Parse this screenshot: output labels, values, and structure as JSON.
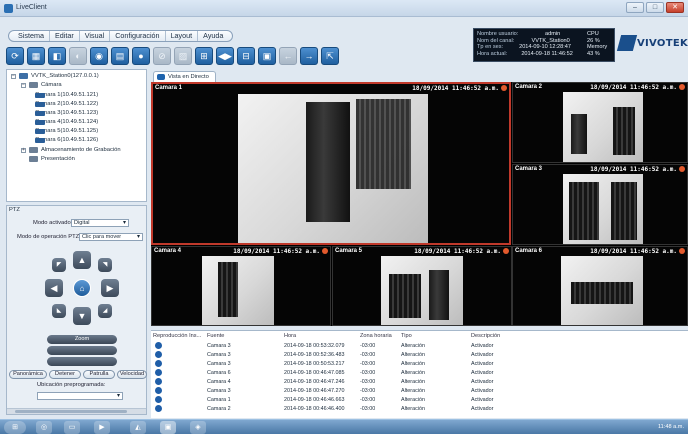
{
  "window": {
    "title": "LiveClient"
  },
  "menu": [
    "Sistema",
    "Editar",
    "Visual",
    "Configuración",
    "Layout",
    "Ayuda"
  ],
  "toolbar_icons": [
    "refresh-icon",
    "layout-icon",
    "snapshot-icon",
    "playback-icon",
    "camera-icon",
    "print-icon",
    "record-icon",
    "disabled-icon",
    "image-icon",
    "grid-icon",
    "sequence-icon",
    "multiview-icon",
    "fullscreen-icon",
    "back-icon",
    "forward-icon",
    "exit-icon"
  ],
  "status": {
    "rows": [
      {
        "k": "Nombre usuario:",
        "v": "admin",
        "k2": "CPU",
        "v2": ""
      },
      {
        "k": "Nom del canal:",
        "v": "VVTK_Station0",
        "k2": "",
        "v2": "26 %"
      },
      {
        "k": "Tp en ses:",
        "v": "2014-09-10 12:28:47",
        "k2": "Memory",
        "v2": ""
      },
      {
        "k": "Hora actual:",
        "v": "2014-09-18 11:46:52",
        "k2": "",
        "v2": "43 %"
      }
    ]
  },
  "brand": "VIVOTEK",
  "tree": {
    "root": "VVTK_Station0(127.0.0.1)",
    "group": "Cámara",
    "cameras": [
      "Camara 1(10.49.51.121)",
      "Camara 2(10.49.51.122)",
      "Camara 3(10.49.51.123)",
      "Camara 4(10.49.51.124)",
      "Camara 5(10.49.51.125)",
      "Camara 6(10.49.51.126)"
    ],
    "storage": "Almacenamiento de Grabación",
    "presentation": "Presentación"
  },
  "ptz": {
    "header": "PTZ",
    "mode_label": "Modo activado:",
    "mode_value": "Digital",
    "op_label": "Modo de operación PTZ:",
    "op_value": "Clic para mover",
    "zoom_label": "Zoom",
    "buttons": [
      "Panorámica",
      "Detener",
      "Patrulla",
      "Velocidad"
    ],
    "preset_label": "Ubicación preprogramada:"
  },
  "main": {
    "tab": "Vista en Directo",
    "cameras": [
      {
        "name": "Camara 1",
        "time": "18/09/2014 11:46:52 a.m."
      },
      {
        "name": "Camara 2",
        "time": "18/09/2014 11:46:52 a.m."
      },
      {
        "name": "Camara 3",
        "time": "18/09/2014 11:46:52 a.m."
      },
      {
        "name": "Camara 4",
        "time": "18/09/2014 11:46:52 a.m."
      },
      {
        "name": "Camara 5",
        "time": "18/09/2014 11:46:52 a.m."
      },
      {
        "name": "Camara 6",
        "time": "18/09/2014 11:46:52 a.m."
      }
    ]
  },
  "events": {
    "headers": [
      "Reproducción Ins...",
      "Fuente",
      "Hora",
      "Zona horaria",
      "Tipo",
      "Descripción"
    ],
    "rows": [
      [
        "Camara 3",
        "2014-09-18 00:53:32.079",
        "-03:00",
        "Alteración",
        "Activador"
      ],
      [
        "Camara 3",
        "2014-09-18 00:52:36.483",
        "-03:00",
        "Alteración",
        "Activador"
      ],
      [
        "Camara 3",
        "2014-09-18 00:50:53.217",
        "-03:00",
        "Alteración",
        "Activador"
      ],
      [
        "Camara 6",
        "2014-09-18 00:46:47.085",
        "-03:00",
        "Alteración",
        "Activador"
      ],
      [
        "Camara 4",
        "2014-09-18 00:46:47.246",
        "-03:00",
        "Alteración",
        "Activador"
      ],
      [
        "Camara 3",
        "2014-09-18 00:46:47.270",
        "-03:00",
        "Alteración",
        "Activador"
      ],
      [
        "Camara 1",
        "2014-09-18 00:46:46.663",
        "-03:00",
        "Alteración",
        "Activador"
      ],
      [
        "Camara 2",
        "2014-09-18 00:46:46.400",
        "-03:00",
        "Alteración",
        "Activador"
      ]
    ]
  },
  "taskbar": {
    "clock": "11:48 a.m."
  }
}
